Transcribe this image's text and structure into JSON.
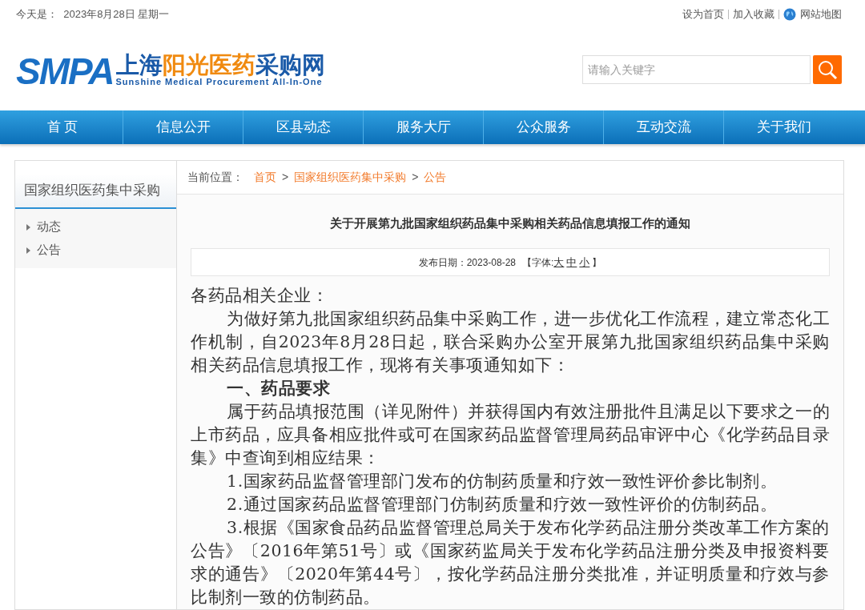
{
  "topbar": {
    "date": "今天是：  2023年8月28日 星期一",
    "links": [
      "设为首页",
      "加入收藏",
      "网站地图"
    ]
  },
  "logo": {
    "mark": "SMPA",
    "name_parts": [
      {
        "text": "上海",
        "kind": "blue"
      },
      {
        "text": "阳光医药",
        "kind": "orange"
      },
      {
        "text": "采购网",
        "kind": "blue"
      }
    ],
    "subtitle": "Sunshine Medical Procurement All-In-One"
  },
  "search": {
    "placeholder": "请输入关键字"
  },
  "nav": [
    {
      "label": "首 页"
    },
    {
      "label": "信息公开"
    },
    {
      "label": "区县动态"
    },
    {
      "label": "服务大厅"
    },
    {
      "label": "公众服务"
    },
    {
      "label": "互动交流"
    },
    {
      "label": "关于我们"
    }
  ],
  "sidebar": {
    "title": "国家组织医药集中采购",
    "items": [
      {
        "label": "动态"
      },
      {
        "label": "公告"
      }
    ]
  },
  "breadcrumb": {
    "label": "当前位置：",
    "separator": ">",
    "items": [
      "首页",
      "国家组织医药集中采购",
      "公告"
    ]
  },
  "article": {
    "title": "关于开展第九批国家组织药品集中采购相关药品信息填报工作的通知",
    "meta": {
      "date": "发布日期：2023-08-28",
      "font_open": "【字体:",
      "sizes": [
        "大",
        "中",
        "小"
      ],
      "font_close": "】"
    },
    "paragraphs": [
      {
        "kind": "salutation",
        "text": "各药品相关企业："
      },
      {
        "kind": "body",
        "text": "为做好第九批国家组织药品集中采购工作，进一步优化工作流程，建立常态化工作机制，自2023年8月28日起，联合采购办公室开展第九批国家组织药品集中采购相关药品信息填报工作，现将有关事项通知如下："
      },
      {
        "kind": "heading",
        "text": "一、药品要求"
      },
      {
        "kind": "body",
        "text": "属于药品填报范围（详见附件）并获得国内有效注册批件且满足以下要求之一的上市药品，应具备相应批件或可在国家药品监督管理局药品审评中心《化学药品目录集》中查询到相应结果："
      },
      {
        "kind": "body",
        "text": "1.国家药品监督管理部门发布的仿制药质量和疗效一致性评价参比制剂。"
      },
      {
        "kind": "body",
        "text": "2.通过国家药品监督管理部门仿制药质量和疗效一致性评价的仿制药品。"
      },
      {
        "kind": "body",
        "text": "3.根据《国家食品药品监督管理总局关于发布化学药品注册分类改革工作方案的公告》〔2016年第51号〕或《国家药监局关于发布化学药品注册分类及申报资料要求的通告》〔2020年第44号〕，按化学药品注册分类批准，并证明质量和疗效与参比制剂一致的仿制药品。"
      }
    ]
  }
}
